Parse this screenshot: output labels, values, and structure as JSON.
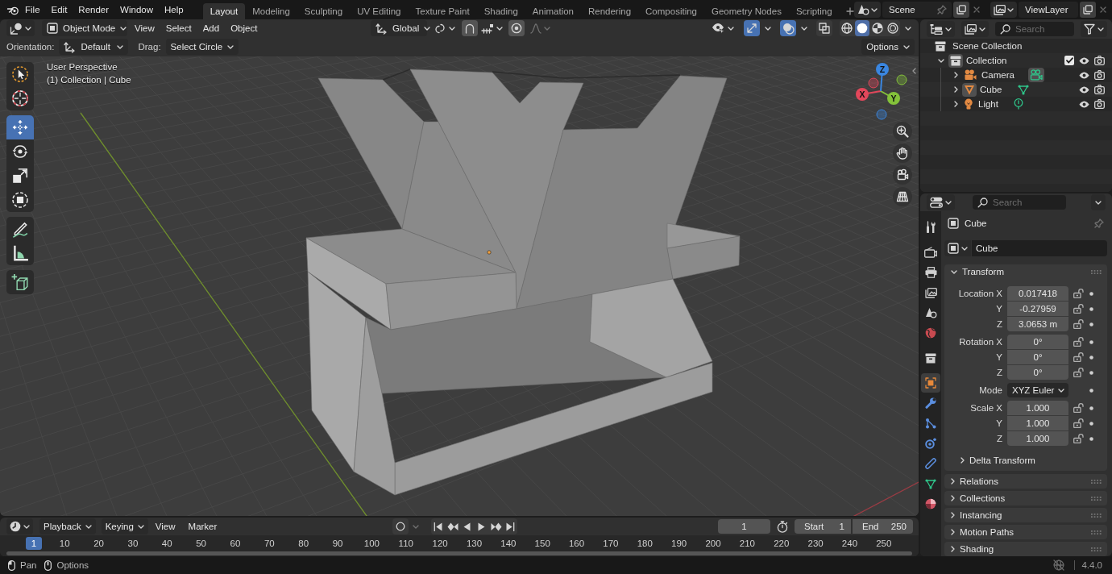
{
  "top_bar": {
    "menus": [
      "File",
      "Edit",
      "Render",
      "Window",
      "Help"
    ],
    "workspaces": [
      {
        "label": "Layout",
        "selected": true
      },
      {
        "label": "Modeling",
        "selected": false
      },
      {
        "label": "Sculpting",
        "selected": false
      },
      {
        "label": "UV Editing",
        "selected": false
      },
      {
        "label": "Texture Paint",
        "selected": false
      },
      {
        "label": "Shading",
        "selected": false
      },
      {
        "label": "Animation",
        "selected": false
      },
      {
        "label": "Rendering",
        "selected": false
      },
      {
        "label": "Compositing",
        "selected": false
      },
      {
        "label": "Geometry Nodes",
        "selected": false
      },
      {
        "label": "Scripting",
        "selected": false
      }
    ],
    "scene": "Scene",
    "view_layer": "ViewLayer"
  },
  "viewport": {
    "header": {
      "mode": "Object Mode",
      "menus": [
        "View",
        "Select",
        "Add",
        "Object"
      ],
      "orientation": "Global",
      "proportional_editing": {
        "on": false
      },
      "toggles": [
        {
          "kind": "gizmos",
          "on": true
        },
        {
          "kind": "overlays",
          "on": true
        },
        {
          "kind": "xray",
          "on": false
        }
      ],
      "shading": [
        {
          "kind": "wireframe",
          "selected": false
        },
        {
          "kind": "solid",
          "selected": true
        },
        {
          "kind": "material",
          "selected": false
        },
        {
          "kind": "rendered",
          "selected": false
        }
      ]
    },
    "tool_settings": {
      "orientation_label": "Orientation:",
      "orientation": "Default",
      "drag_label": "Drag:",
      "drag": "Select Circle",
      "options": "Options"
    },
    "tool_groups": [
      {
        "tools": [
          {
            "kind": "select",
            "selected": false
          },
          {
            "kind": "cursor",
            "selected": false
          }
        ]
      },
      {
        "tools": [
          {
            "kind": "move",
            "selected": true
          },
          {
            "kind": "rotate",
            "selected": false
          },
          {
            "kind": "scale",
            "selected": false
          },
          {
            "kind": "transform",
            "selected": false
          }
        ]
      },
      {
        "tools": [
          {
            "kind": "annotate",
            "selected": false
          },
          {
            "kind": "measure",
            "selected": false
          }
        ]
      },
      {
        "tools": [
          {
            "kind": "add_cube",
            "selected": false
          }
        ]
      }
    ],
    "info": [
      "User Perspective",
      "(1) Collection | Cube"
    ],
    "gizmo": [
      {
        "label": "X",
        "color": "#e2475b"
      },
      {
        "label": "Y",
        "color": "#84c23a"
      },
      {
        "label": "Z",
        "color": "#3a86e0"
      }
    ]
  },
  "timeline": {
    "menus": [
      {
        "label": "Playback",
        "kind": "dropdown"
      },
      {
        "label": "Keying",
        "kind": "dropdown"
      },
      {
        "label": "View",
        "kind": "menu"
      },
      {
        "label": "Marker",
        "kind": "menu"
      }
    ],
    "auto_keying": {
      "on": false
    },
    "current_frame": "1",
    "preview_range": {
      "on": false
    },
    "start_label": "Start",
    "start": "1",
    "end_label": "End",
    "end": "250",
    "playhead": "1",
    "ruler": [
      "10",
      "20",
      "30",
      "40",
      "50",
      "60",
      "70",
      "80",
      "90",
      "100",
      "110",
      "120",
      "130",
      "140",
      "150",
      "160",
      "170",
      "180",
      "190",
      "200",
      "210",
      "220",
      "230",
      "240",
      "250"
    ]
  },
  "outliner": {
    "search_placeholder": "Search",
    "root": "Scene Collection",
    "items": [
      {
        "label": "Collection",
        "expanded": true,
        "active": true,
        "checked": true,
        "visible": true,
        "renderable": true,
        "children": [
          {
            "label": "Camera",
            "kind": "camera",
            "expanded": false,
            "active": false,
            "data_active": true,
            "visible": true,
            "renderable": true
          },
          {
            "label": "Cube",
            "kind": "mesh",
            "expanded": false,
            "active": true,
            "data_active": false,
            "visible": true,
            "renderable": true
          },
          {
            "label": "Light",
            "kind": "light",
            "expanded": false,
            "active": false,
            "data_active": false,
            "visible": true,
            "renderable": true
          }
        ]
      }
    ]
  },
  "properties": {
    "search_placeholder": "Search",
    "tabs": [
      {
        "kind": "tool",
        "selected": false
      },
      {
        "kind": "render",
        "selected": false
      },
      {
        "kind": "output",
        "selected": false
      },
      {
        "kind": "view_layer",
        "selected": false
      },
      {
        "kind": "scene",
        "selected": false
      },
      {
        "kind": "world",
        "selected": false
      },
      {
        "kind": "collection",
        "selected": false
      },
      {
        "kind": "object",
        "selected": true
      },
      {
        "kind": "modifiers",
        "selected": false
      },
      {
        "kind": "particles",
        "selected": false
      },
      {
        "kind": "physics",
        "selected": false
      },
      {
        "kind": "constraints",
        "selected": false
      },
      {
        "kind": "data",
        "selected": false
      },
      {
        "kind": "material",
        "selected": false
      }
    ],
    "context": "Cube",
    "object_name": "Cube",
    "transform": {
      "title": "Transform",
      "expanded": true,
      "groups": [
        {
          "kind": "vector",
          "rows": [
            {
              "label": "Location X",
              "value": "0.017418",
              "locked": false
            },
            {
              "label": "Y",
              "value": "-0.27959",
              "locked": false
            },
            {
              "label": "Z",
              "value": "3.0653 m",
              "locked": false
            }
          ]
        },
        {
          "kind": "vector",
          "rows": [
            {
              "label": "Rotation X",
              "value": "0°",
              "locked": false
            },
            {
              "label": "Y",
              "value": "0°",
              "locked": false
            },
            {
              "label": "Z",
              "value": "0°",
              "locked": false
            }
          ]
        },
        {
          "kind": "dropdown",
          "rows": [
            {
              "label": "Mode",
              "value": "XYZ Euler"
            }
          ]
        },
        {
          "kind": "vector",
          "rows": [
            {
              "label": "Scale X",
              "value": "1.000",
              "locked": false
            },
            {
              "label": "Y",
              "value": "1.000",
              "locked": false
            },
            {
              "label": "Z",
              "value": "1.000",
              "locked": false
            }
          ]
        }
      ],
      "subpanel": {
        "title": "Delta Transform",
        "expanded": false
      }
    },
    "panels": [
      {
        "title": "Relations",
        "expanded": false
      },
      {
        "title": "Collections",
        "expanded": false
      },
      {
        "title": "Instancing",
        "expanded": false
      },
      {
        "title": "Motion Paths",
        "expanded": false
      },
      {
        "title": "Shading",
        "expanded": false
      }
    ]
  },
  "status_bar": {
    "hints": [
      {
        "kind": "mouse_left",
        "label": "Pan"
      },
      {
        "kind": "mouse_middle",
        "label": "Options"
      }
    ],
    "version": "4.4.0"
  }
}
